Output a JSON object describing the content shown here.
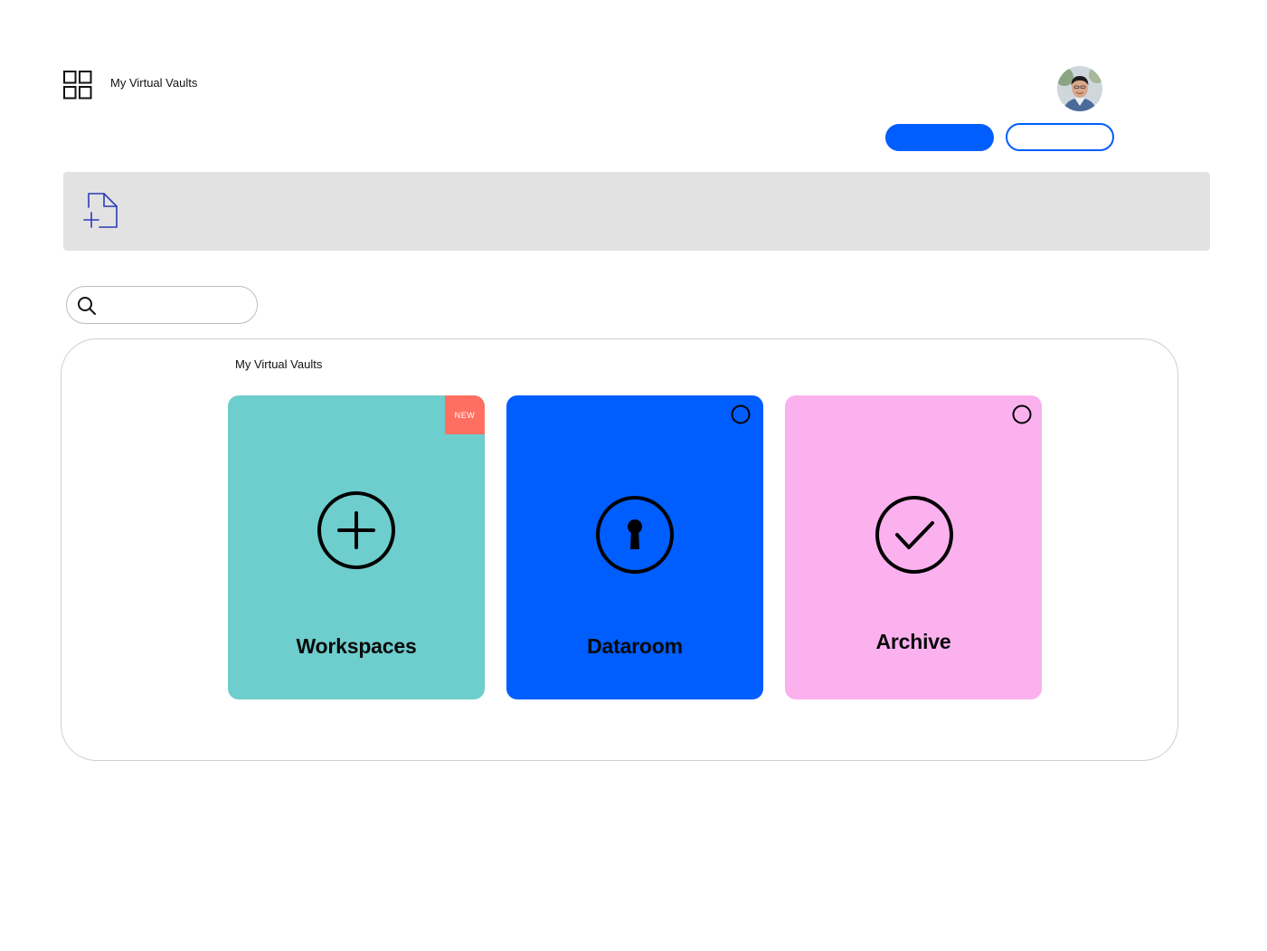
{
  "header": {
    "app_title": "My Virtual Vaults",
    "primary_button_label": "",
    "secondary_button_label": ""
  },
  "search": {
    "value": "",
    "placeholder": ""
  },
  "panel": {
    "title": "My Virtual Vaults",
    "cards": [
      {
        "label": "Workspaces",
        "icon": "plus-circle-icon",
        "color": "#6ecdcd",
        "badge": "NEW"
      },
      {
        "label": "Dataroom",
        "icon": "keyhole-icon",
        "color": "#005eff"
      },
      {
        "label": "Archive",
        "icon": "check-circle-icon",
        "color": "#fbb1ee"
      }
    ]
  },
  "colors": {
    "accent": "#005eff",
    "badge": "#ff6f61",
    "upload_bar": "#e2e2e2",
    "upload_icon": "#2a3bb7"
  }
}
